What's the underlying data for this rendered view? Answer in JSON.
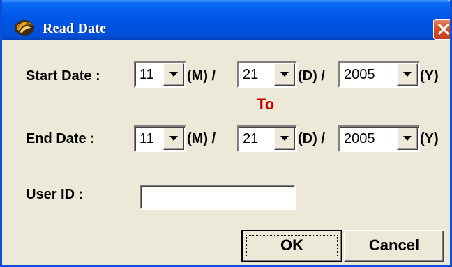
{
  "window": {
    "title": "Read Date",
    "icon": "app-logo-icon",
    "close_icon": "close-icon"
  },
  "start_date": {
    "label": "Start Date :",
    "month": "11",
    "month_unit": "(M) /",
    "day": "21",
    "day_unit": "(D) /",
    "year": "2005",
    "year_unit": "(Y)"
  },
  "separator": {
    "text": "To",
    "color": "#cc0000"
  },
  "end_date": {
    "label": "End Date :",
    "month": "11",
    "month_unit": "(M) /",
    "day": "21",
    "day_unit": "(D) /",
    "year": "2005",
    "year_unit": "(Y)"
  },
  "user_id": {
    "label": "User ID :",
    "value": ""
  },
  "buttons": {
    "ok": "OK",
    "cancel": "Cancel"
  },
  "colors": {
    "titlebar": "#0054e3",
    "dialog_bg": "#ece9d8",
    "close_button": "#d4502a"
  }
}
